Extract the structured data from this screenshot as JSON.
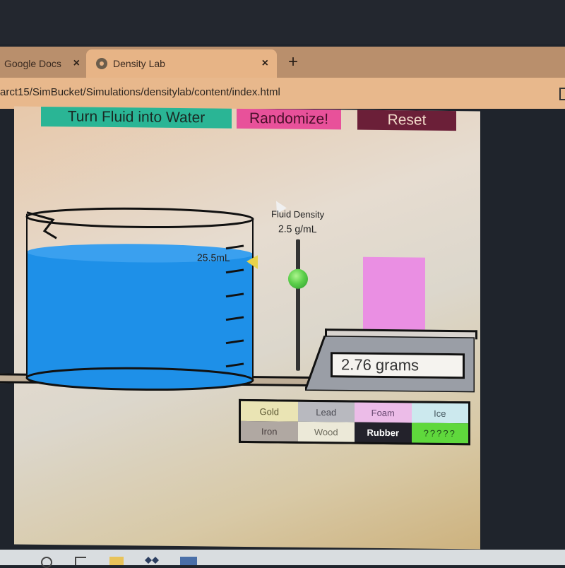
{
  "browser": {
    "tabs": [
      {
        "title": "Google Docs",
        "active": false,
        "close_label": "×"
      },
      {
        "title": "Density Lab",
        "active": true,
        "close_label": "×",
        "icon": "gear-icon"
      }
    ],
    "new_tab_label": "+",
    "url": "arct15/SimBucket/Simulations/densitylab/content/index.html"
  },
  "sim": {
    "buttons": {
      "water": "Turn Fluid into Water",
      "randomize": "Randomize!",
      "reset": "Reset"
    },
    "beaker": {
      "volume_label": "25.5mL",
      "fluid_color": "#1e90e8"
    },
    "fluid_density": {
      "label": "Fluid Density",
      "value": "2.5 g/mL"
    },
    "block": {
      "color": "#ea8fe3"
    },
    "scale": {
      "reading": "2.76 grams"
    },
    "materials": [
      {
        "name": "Gold",
        "cls": "mat-gold"
      },
      {
        "name": "Lead",
        "cls": "mat-lead"
      },
      {
        "name": "Foam",
        "cls": "mat-foam"
      },
      {
        "name": "Ice",
        "cls": "mat-ice"
      },
      {
        "name": "Iron",
        "cls": "mat-iron"
      },
      {
        "name": "Wood",
        "cls": "mat-wood"
      },
      {
        "name": "Rubber",
        "cls": "mat-rubber",
        "selected": true
      },
      {
        "name": "?????",
        "cls": "mat-unknown"
      }
    ]
  },
  "taskbar": {
    "icons": [
      "search-icon",
      "task-view-icon",
      "folder-icon",
      "dropbox-icon",
      "app-icon"
    ]
  }
}
